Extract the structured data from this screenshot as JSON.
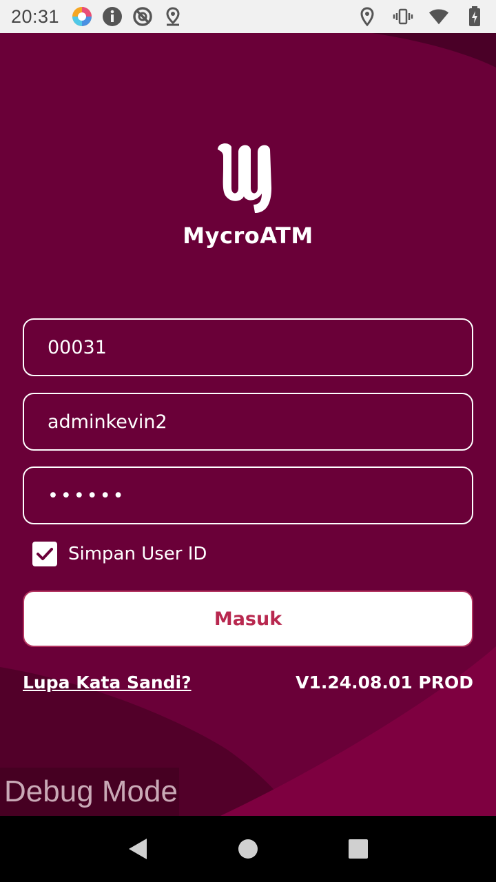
{
  "status_bar": {
    "time": "20:31",
    "left_icons": [
      "app-launcher-icon",
      "info-icon",
      "no-disturb-icon",
      "location-pin-icon"
    ],
    "right_icons": [
      "location-icon",
      "vibrate-icon",
      "wifi-icon",
      "battery-charging-icon"
    ]
  },
  "app": {
    "brand": "MycroATM",
    "fields": {
      "outlet_id": "00031",
      "user_id": "adminkevin2",
      "password": "••••••"
    },
    "remember": {
      "label": "Simpan User ID",
      "checked": true
    },
    "login_button": "Masuk",
    "forgot_password": "Lupa Kata Sandi?",
    "version": "V1.24.08.01 PROD",
    "debug_label": "Debug Mode"
  },
  "colors": {
    "background": "#6a0038",
    "accent": "#b8284f",
    "white": "#ffffff"
  },
  "nav_bar": {
    "icons": [
      "back-icon",
      "home-icon",
      "recents-icon"
    ]
  }
}
